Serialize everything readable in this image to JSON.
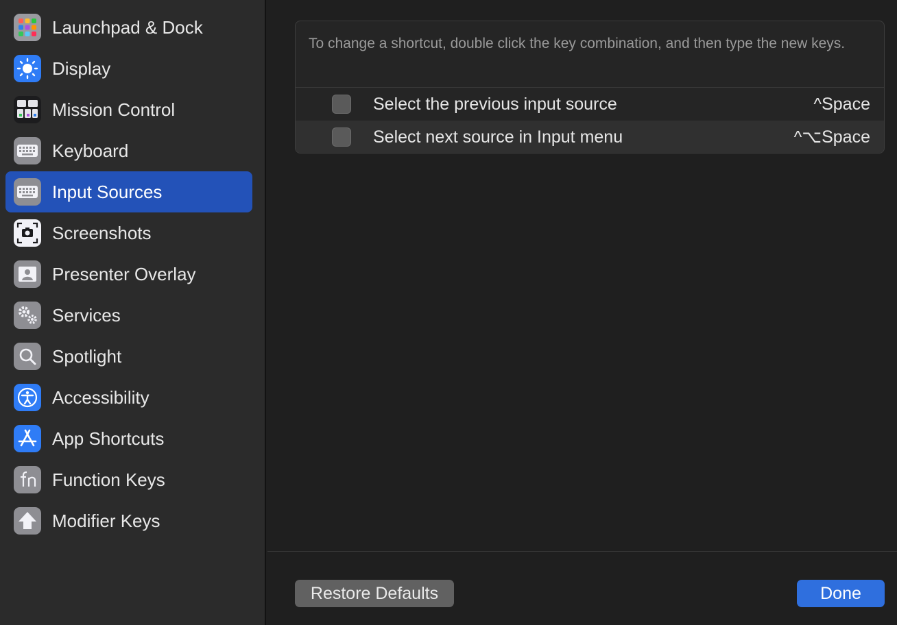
{
  "sidebar": {
    "items": [
      {
        "label": "Launchpad & Dock",
        "icon": "launchpad-icon",
        "selected": false
      },
      {
        "label": "Display",
        "icon": "display-icon",
        "selected": false
      },
      {
        "label": "Mission Control",
        "icon": "mission-control-icon",
        "selected": false
      },
      {
        "label": "Keyboard",
        "icon": "keyboard-icon",
        "selected": false
      },
      {
        "label": "Input Sources",
        "icon": "keyboard-icon",
        "selected": true
      },
      {
        "label": "Screenshots",
        "icon": "screenshot-icon",
        "selected": false
      },
      {
        "label": "Presenter Overlay",
        "icon": "presenter-overlay-icon",
        "selected": false
      },
      {
        "label": "Services",
        "icon": "gears-icon",
        "selected": false
      },
      {
        "label": "Spotlight",
        "icon": "magnifier-icon",
        "selected": false
      },
      {
        "label": "Accessibility",
        "icon": "accessibility-icon",
        "selected": false
      },
      {
        "label": "App Shortcuts",
        "icon": "app-store-icon",
        "selected": false
      },
      {
        "label": "Function Keys",
        "icon": "fn-icon",
        "selected": false
      },
      {
        "label": "Modifier Keys",
        "icon": "shift-arrow-icon",
        "selected": false
      }
    ]
  },
  "main": {
    "description": "To change a shortcut, double click the key combination, and then type the new keys.",
    "shortcuts": [
      {
        "label": "Select the previous input source",
        "keys": "^Space",
        "checked": false
      },
      {
        "label": "Select next source in Input menu",
        "keys": "^⌥Space",
        "checked": false
      }
    ]
  },
  "footer": {
    "restore_label": "Restore Defaults",
    "done_label": "Done"
  },
  "colors": {
    "sidebar_bg": "#2b2b2b",
    "main_bg": "#1f1f1f",
    "selection": "#2352b8",
    "accent": "#2f6fde"
  }
}
